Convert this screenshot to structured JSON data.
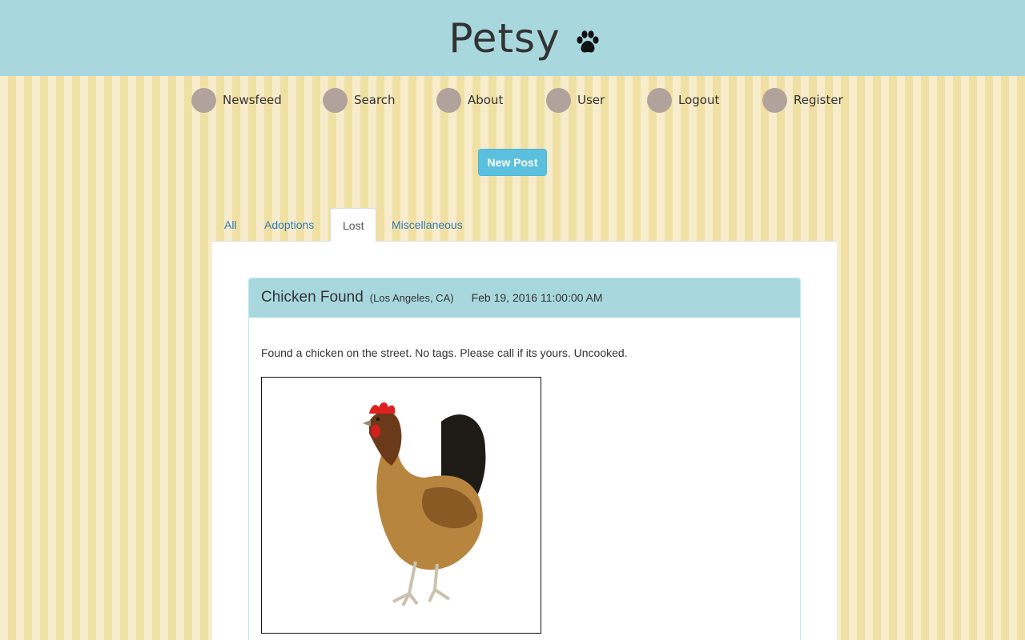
{
  "header": {
    "brand": "Petsy"
  },
  "nav": {
    "items": [
      {
        "label": "Newsfeed"
      },
      {
        "label": "Search"
      },
      {
        "label": "About"
      },
      {
        "label": "User"
      },
      {
        "label": "Logout"
      },
      {
        "label": "Register"
      }
    ]
  },
  "actions": {
    "new_post_label": "New Post"
  },
  "tabs": [
    {
      "label": "All",
      "active": false
    },
    {
      "label": "Adoptions",
      "active": false
    },
    {
      "label": "Lost",
      "active": true
    },
    {
      "label": "Miscellaneous",
      "active": false
    }
  ],
  "post": {
    "title": "Chicken Found",
    "location": "(Los Angeles, CA)",
    "date": "Feb 19, 2016 11:00:00 AM",
    "body": "Found a chicken on the street. No tags. Please call if its yours. Uncooked."
  },
  "colors": {
    "header_bg": "#a8d8de",
    "nav_dot": "#b1a29c",
    "button_bg": "#5bc0de",
    "tab_link": "#337ab7"
  }
}
